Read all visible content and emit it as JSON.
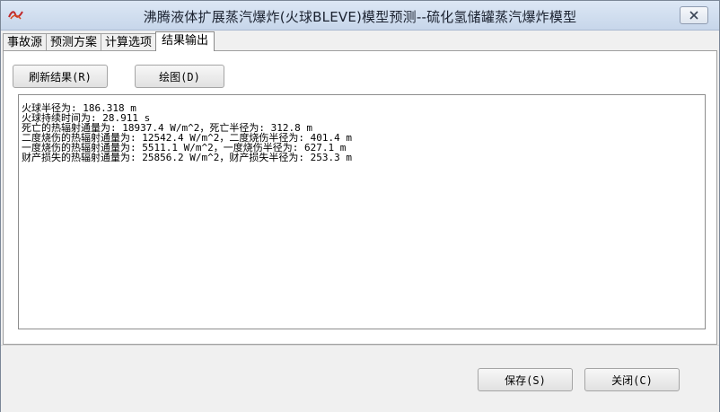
{
  "window": {
    "title": "沸腾液体扩展蒸汽爆炸(火球BLEVE)模型预测--硫化氢储罐蒸汽爆炸模型",
    "close_icon": "close-icon",
    "app_icon": "app-logo-icon"
  },
  "tabs": [
    {
      "label": "事故源",
      "active": false
    },
    {
      "label": "预测方案",
      "active": false
    },
    {
      "label": "计算选项",
      "active": false
    },
    {
      "label": "结果输出",
      "active": true
    }
  ],
  "toolbar": {
    "refresh_label": "刷新结果(R)",
    "plot_label": "绘图(D)"
  },
  "results": {
    "lines": [
      "火球半径为: 186.318 m",
      "火球持续时间为: 28.911 s",
      "死亡的热辐射通量为: 18937.4 W/m^2，死亡半径为: 312.8 m",
      "二度烧伤的热辐射通量为: 12542.4 W/m^2，二度烧伤半径为: 401.4 m",
      "一度烧伤的热辐射通量为: 5511.1 W/m^2，一度烧伤半径为: 627.1 m",
      "财产损失的热辐射通量为: 25856.2 W/m^2，财产损失半径为: 253.3 m"
    ]
  },
  "footer": {
    "save_label": "保存(S)",
    "close_label": "关闭(C)"
  },
  "colors": {
    "titlebar": "#c7d6ea",
    "panel": "#ffffff",
    "window": "#f0f0f0"
  }
}
